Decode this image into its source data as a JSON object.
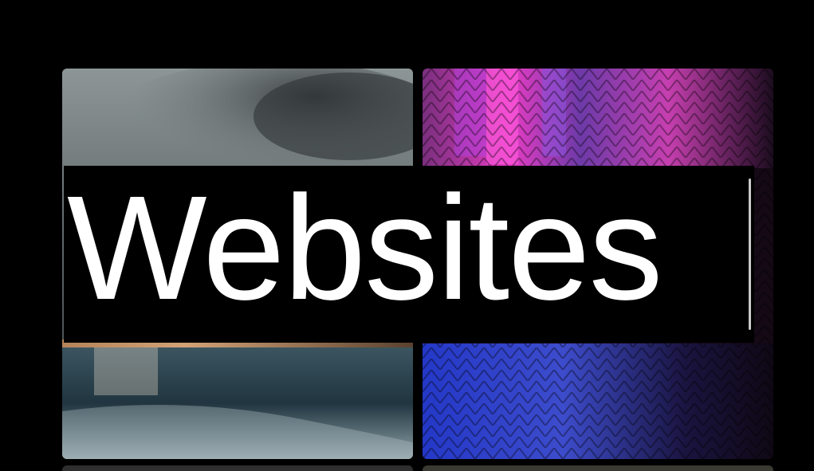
{
  "hero": {
    "title": "Websites"
  },
  "tiles": [
    {
      "icon": "lake-cloudy-photo"
    },
    {
      "icon": "neon-wet-pavement-photo"
    },
    {
      "icon": "bottom-left-photo"
    },
    {
      "icon": "bottom-right-photo"
    }
  ],
  "colors": {
    "background": "#000000",
    "title_text": "#ffffff",
    "band": "#000000",
    "scrollbar": "#c9c9c9"
  }
}
